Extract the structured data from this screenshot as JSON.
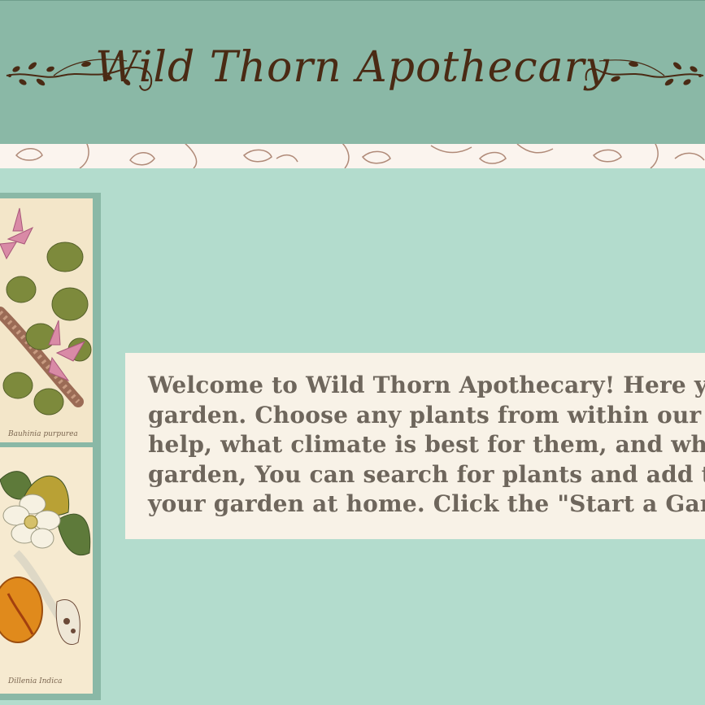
{
  "header": {
    "title": "Wild Thorn Apothecary"
  },
  "colors": {
    "header_bg": "#8ab8a6",
    "page_bg": "#b3dccd",
    "title_text": "#4a2a14",
    "panel_bg": "#f8f2e7",
    "body_text": "#6e665c"
  },
  "decor": {
    "left_ornament": "vine-flourish-icon",
    "right_ornament": "vine-flourish-icon",
    "band": "leaf-pattern"
  },
  "gallery": {
    "plates": [
      {
        "name": "botanical-plate-pink-orchid",
        "caption": "Bauhinia purpurea"
      },
      {
        "name": "botanical-plate-magnolia-fruit",
        "caption": "Dillenia Indica"
      }
    ]
  },
  "welcome": {
    "lines": [
      "Welcome to Wild Thorn Apothecary! Here you ca",
      "garden. Choose any plants from within our datab",
      "help, what climate is best for them, and what t",
      "garden, You can search for plants and add them",
      "your garden at home. Click the \"Start a Garden\""
    ]
  }
}
